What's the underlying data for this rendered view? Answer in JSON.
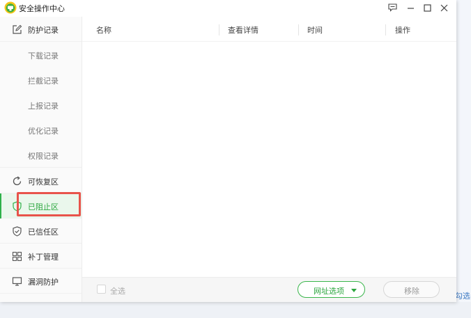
{
  "window": {
    "title": "安全操作中心",
    "controls": [
      "feedback-icon",
      "minimize-icon",
      "maximize-icon",
      "close-icon"
    ]
  },
  "sidebar": {
    "items": [
      {
        "label": "防护记录",
        "icon": "edit-icon",
        "level": "main"
      },
      {
        "label": "下载记录",
        "level": "sub"
      },
      {
        "label": "拦截记录",
        "level": "sub"
      },
      {
        "label": "上报记录",
        "level": "sub"
      },
      {
        "label": "优化记录",
        "level": "sub"
      },
      {
        "label": "权限记录",
        "level": "sub"
      },
      {
        "label": "可恢复区",
        "icon": "restore-icon",
        "level": "main"
      },
      {
        "label": "已阻止区",
        "icon": "shield-icon",
        "level": "main",
        "active": true
      },
      {
        "label": "已信任区",
        "icon": "shield-check-icon",
        "level": "main"
      },
      {
        "label": "补丁管理",
        "icon": "grid-icon",
        "level": "main"
      },
      {
        "label": "漏洞防护",
        "icon": "monitor-icon",
        "level": "main"
      }
    ]
  },
  "table": {
    "columns": [
      "名称",
      "查看详情",
      "时间",
      "操作"
    ],
    "rows": []
  },
  "footer": {
    "select_all": "全选",
    "url_options": "网址选项",
    "remove": "移除"
  },
  "background": {
    "link_text": "勾选"
  },
  "colors": {
    "accent_green": "#2fb14a",
    "highlight_red": "#e8534b",
    "link_blue": "#3a78c2"
  }
}
